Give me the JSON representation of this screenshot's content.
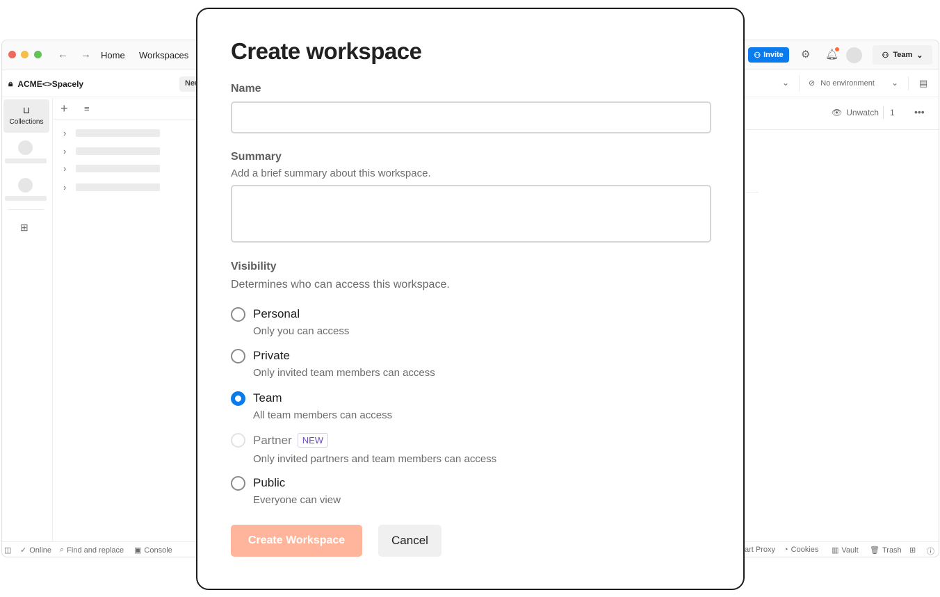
{
  "app": {
    "nav": {
      "home": "Home",
      "workspaces": "Workspaces"
    },
    "toolbar": {
      "invite": "Invite",
      "team": "Team"
    },
    "workspace_name": "ACME<>Spacely",
    "new_button": "New",
    "environment": "No environment",
    "rail": {
      "collections": "Collections"
    },
    "watch": {
      "label": "Unwatch",
      "count": "1"
    },
    "statusbar": {
      "online": "Online",
      "find_replace": "Find and replace",
      "console": "Console",
      "proxy": "art Proxy",
      "cookies": "Cookies",
      "vault": "Vault",
      "trash": "Trash"
    }
  },
  "modal": {
    "title": "Create workspace",
    "name": {
      "label": "Name",
      "value": ""
    },
    "summary": {
      "label": "Summary",
      "help": "Add a brief summary about this workspace.",
      "value": ""
    },
    "visibility": {
      "label": "Visibility",
      "help": "Determines who can access this workspace.",
      "options": [
        {
          "label": "Personal",
          "desc": "Only you can access",
          "checked": false,
          "disabled": false
        },
        {
          "label": "Private",
          "desc": "Only invited team members can access",
          "checked": false,
          "disabled": false
        },
        {
          "label": "Team",
          "desc": "All team members can access",
          "checked": true,
          "disabled": false
        },
        {
          "label": "Partner",
          "badge": "NEW",
          "desc": "Only invited partners and team members can access",
          "checked": false,
          "disabled": true
        },
        {
          "label": "Public",
          "desc": "Everyone can view",
          "checked": false,
          "disabled": false
        }
      ]
    },
    "create_button": "Create Workspace",
    "cancel_button": "Cancel"
  },
  "colors": {
    "accent": "#097bed",
    "create_disabled": "#ffb59b",
    "notification": "#ff6c37"
  }
}
